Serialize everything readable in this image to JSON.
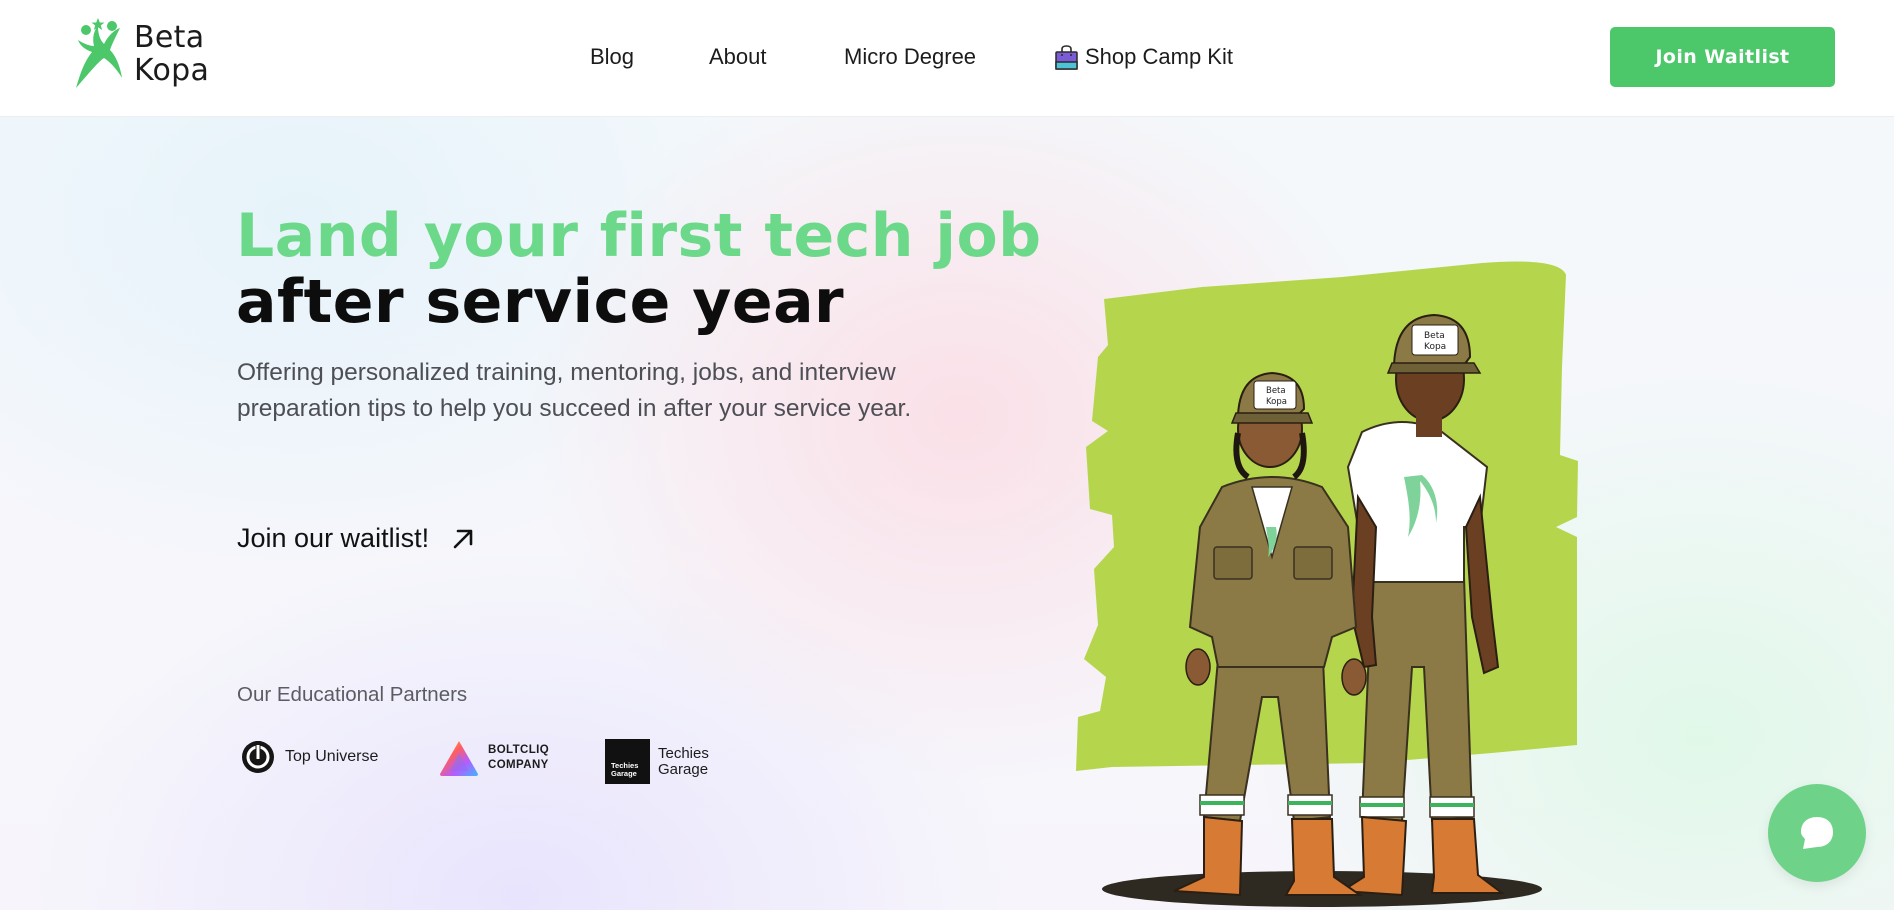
{
  "brand": {
    "line1": "Beta",
    "line2": "Kopa",
    "color": "#4cc76a"
  },
  "nav": {
    "items": [
      {
        "label": "Blog"
      },
      {
        "label": "About"
      },
      {
        "label": "Micro Degree"
      },
      {
        "label": "Shop Camp Kit",
        "icon": "shopping-bag-icon"
      }
    ],
    "cta_label": "Join Waitlist"
  },
  "hero": {
    "headline_accent": "Land your first tech job",
    "headline_main": "after service year",
    "subtext": "Offering personalized training, mentoring, jobs, and interview preparation tips to help you succeed in after your service year.",
    "link_label": "Join our waitlist!",
    "link_icon": "arrow-up-right-icon",
    "accent_color": "#6cd98a"
  },
  "partners": {
    "title": "Our Educational Partners",
    "items": [
      {
        "name": "Top Universe",
        "icon": "top-universe-logo"
      },
      {
        "name_line1": "BOLTCLIQ",
        "name_line2": "COMPANY",
        "icon": "boltcliq-logo"
      },
      {
        "name_line1": "Techies",
        "name_line2": "Garage",
        "box_line1": "Techies",
        "box_line2": "Garage",
        "icon": "techies-garage-logo"
      }
    ]
  },
  "illustration": {
    "cap_text_line1": "Beta",
    "cap_text_line2": "Kopa",
    "backdrop_color": "#b5d64c",
    "uniform_color": "#8b7a45"
  },
  "chat": {
    "icon": "chat-bubble-icon",
    "color": "#6fd289"
  }
}
